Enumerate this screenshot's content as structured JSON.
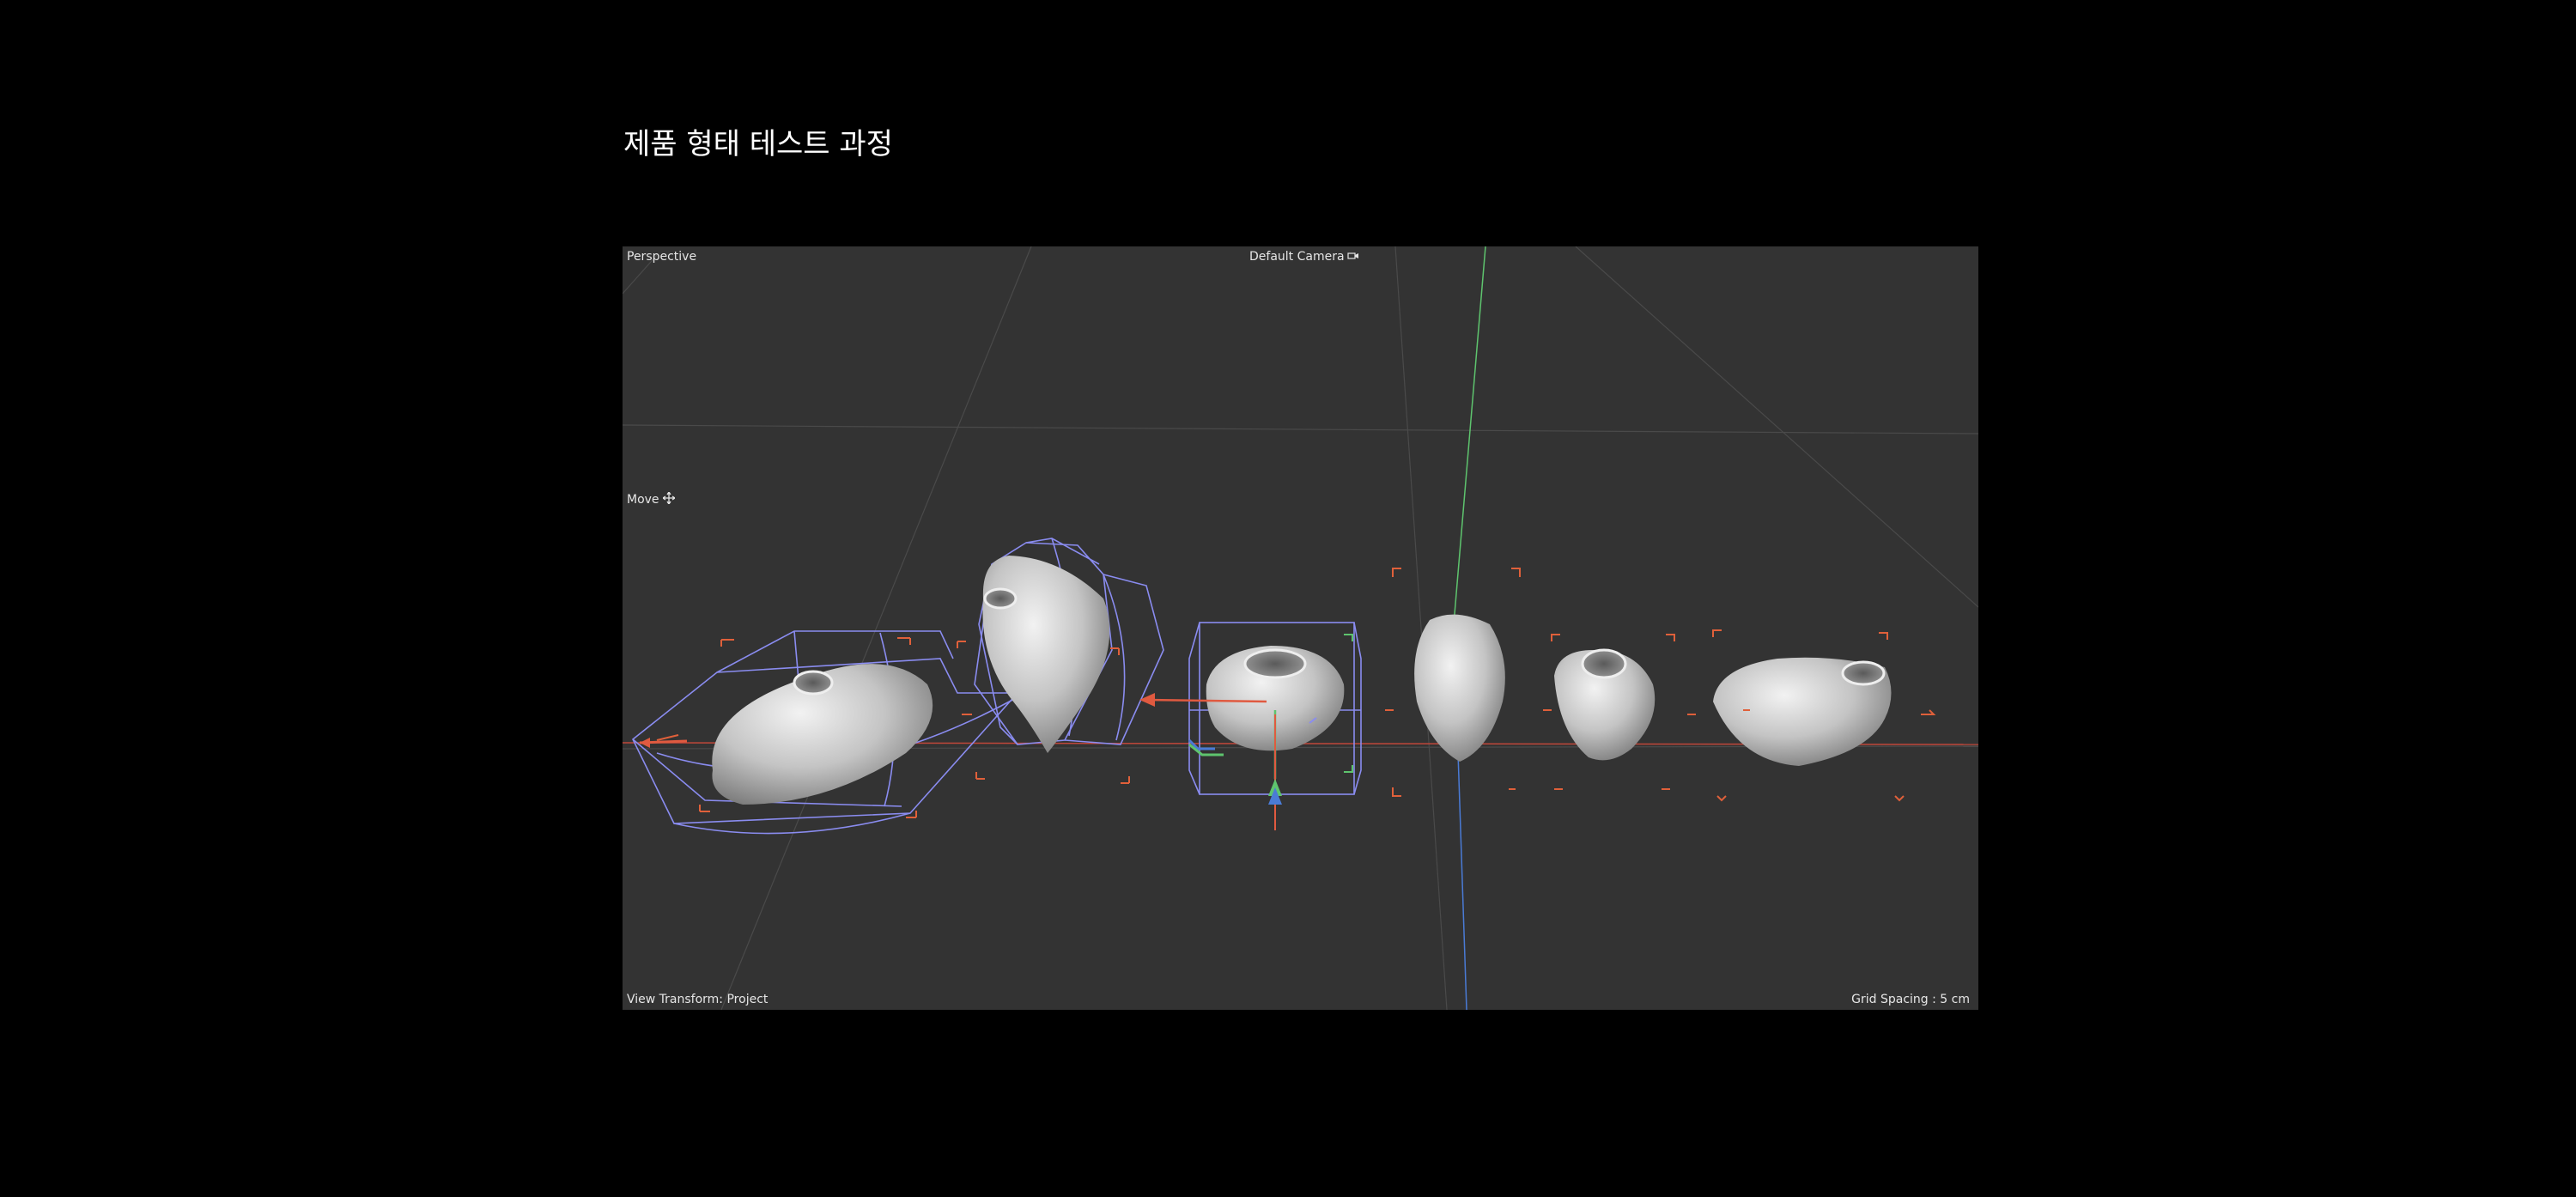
{
  "page": {
    "title": "제품 형태 테스트 과정"
  },
  "viewport": {
    "view_name": "Perspective",
    "camera_label": "Default Camera",
    "camera_icon": "camera-icon",
    "tool_label": "Move",
    "tool_icon": "move-icon",
    "view_transform": "View Transform: Project",
    "grid_spacing": "Grid Spacing : 5 cm",
    "colors": {
      "background": "#333333",
      "grid": "#4a4a4a",
      "x_axis": "#e05a40",
      "y_axis": "#5ec46e",
      "z_axis": "#4a7bd6",
      "selection_cage": "#8a8cf0",
      "bracket": "#e0603a",
      "model": "#cfcfcf"
    },
    "objects": [
      {
        "name": "shape-1",
        "selected": true
      },
      {
        "name": "shape-2",
        "selected": true
      },
      {
        "name": "shape-3",
        "selected": true
      },
      {
        "name": "shape-4",
        "selected": false
      },
      {
        "name": "shape-5",
        "selected": false
      },
      {
        "name": "shape-6",
        "selected": false
      }
    ]
  }
}
